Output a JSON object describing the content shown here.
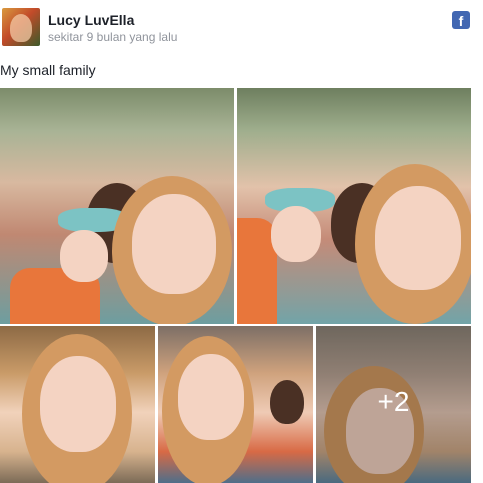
{
  "post": {
    "author": "Lucy LuvElla",
    "timestamp": "sekitar 9 bulan yang lalu",
    "caption": "My small family"
  },
  "platform_icon": "facebook-icon",
  "photos": {
    "more_count": "+2"
  },
  "colors": {
    "author": "#1d2129",
    "timestamp": "#90949c",
    "facebook_blue": "#4267b2"
  }
}
